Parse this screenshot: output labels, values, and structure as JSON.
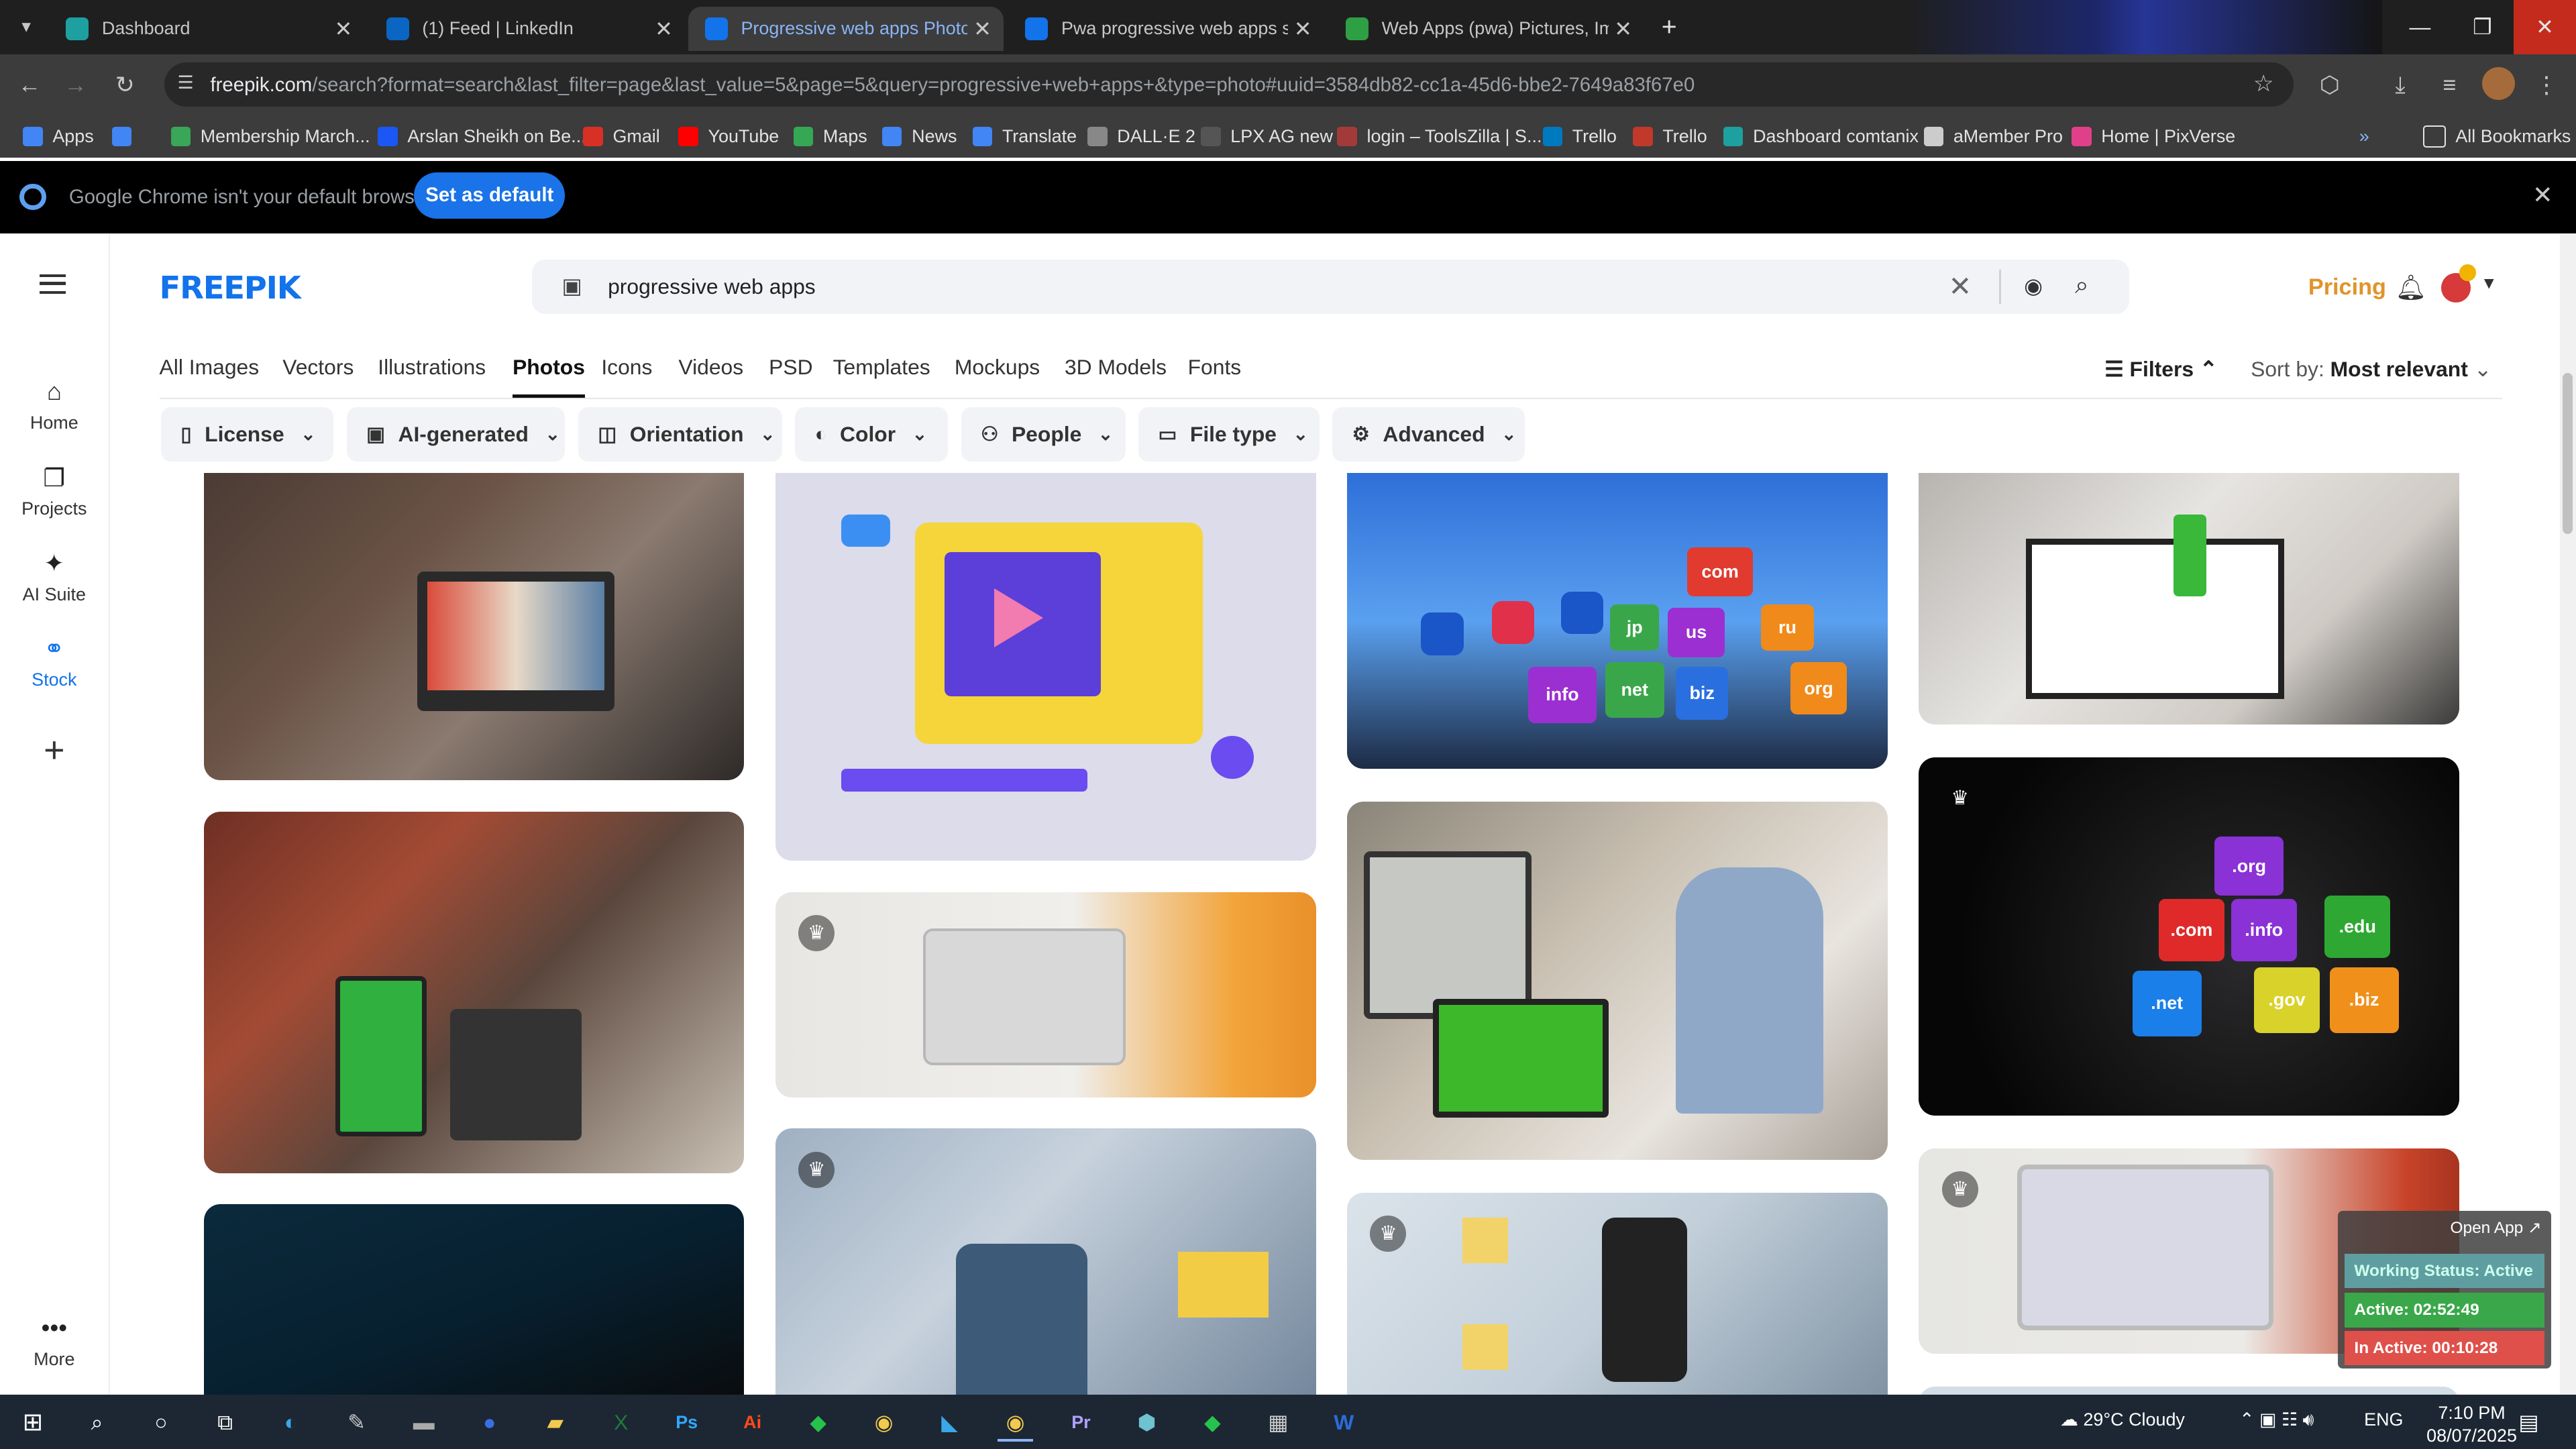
{
  "browser": {
    "tabs": [
      {
        "title": "Dashboard",
        "active": false,
        "favicon_color": "#1ea0a0"
      },
      {
        "title": "(1) Feed | LinkedIn",
        "active": false,
        "favicon_color": "#0a66c2"
      },
      {
        "title": "Progressive web apps Photos | Fr",
        "active": true,
        "favicon_color": "#1273eb"
      },
      {
        "title": "Pwa progressive web apps sma",
        "active": false,
        "favicon_color": "#1273eb"
      },
      {
        "title": "Web Apps (pwa) Pictures, Imag",
        "active": false,
        "favicon_color": "#2ea043"
      }
    ],
    "url_host": "freepik.com",
    "url_path": "/search?format=search&last_filter=page&last_value=5&page=5&query=progressive+web+apps+&type=photo#uuid=3584db82-cc1a-45d6-bbe2-7649a83f67e0",
    "bookmarks": [
      {
        "label": "Apps",
        "color": "#4285f4"
      },
      {
        "label": "",
        "color": "#4285f4"
      },
      {
        "label": "Membership March...",
        "color": "#3aa657"
      },
      {
        "label": "Arslan Sheikh on Be...",
        "color": "#1a57f5"
      },
      {
        "label": "Gmail",
        "color": "#d93025"
      },
      {
        "label": "YouTube",
        "color": "#ff0000"
      },
      {
        "label": "Maps",
        "color": "#34a853"
      },
      {
        "label": "News",
        "color": "#4285f4"
      },
      {
        "label": "Translate",
        "color": "#4285f4"
      },
      {
        "label": "DALL·E 2",
        "color": "#888888"
      },
      {
        "label": "LPX AG new",
        "color": "#555555"
      },
      {
        "label": "login – ToolsZilla | S...",
        "color": "#a33a3a"
      },
      {
        "label": "Trello",
        "color": "#0079bf"
      },
      {
        "label": "Trello",
        "color": "#c0392b"
      },
      {
        "label": "Dashboard comtanix",
        "color": "#1ea0a0"
      },
      {
        "label": "aMember Pro",
        "color": "#cccccc"
      },
      {
        "label": "Home | PixVerse",
        "color": "#e0408a"
      }
    ],
    "all_bookmarks": "All Bookmarks",
    "infobar_message": "Google Chrome isn't your default browser",
    "infobar_button": "Set as default"
  },
  "site": {
    "logo": "FREEPIK",
    "search_query": "progressive web apps",
    "pricing": "Pricing",
    "sidenav": [
      {
        "label": "Home",
        "icon": "home-icon",
        "glyph": "⌂"
      },
      {
        "label": "Projects",
        "icon": "projects-icon",
        "glyph": "❐"
      },
      {
        "label": "AI Suite",
        "icon": "ai-suite-icon",
        "glyph": "✦"
      },
      {
        "label": "Stock",
        "icon": "stock-icon",
        "glyph": "⚭"
      },
      {
        "label": "",
        "icon": "plus-icon",
        "glyph": "+"
      },
      {
        "label": "More",
        "icon": "more-icon",
        "glyph": "•••"
      }
    ],
    "type_tabs": [
      "All Images",
      "Vectors",
      "Illustrations",
      "Photos",
      "Icons",
      "Videos",
      "PSD",
      "Templates",
      "Mockups",
      "3D Models",
      "Fonts"
    ],
    "active_type_tab": "Photos",
    "filters_label": "Filters",
    "sort_label": "Sort by:",
    "sort_value": "Most relevant",
    "filter_chips": [
      {
        "label": "License",
        "icon": "license-icon"
      },
      {
        "label": "AI-generated",
        "icon": "ai-generated-icon"
      },
      {
        "label": "Orientation",
        "icon": "orientation-icon"
      },
      {
        "label": "Color",
        "icon": "color-icon"
      },
      {
        "label": "People",
        "icon": "people-icon"
      },
      {
        "label": "File type",
        "icon": "file-type-icon"
      },
      {
        "label": "Advanced",
        "icon": "advanced-icon"
      }
    ],
    "domain_cubes_1": [
      "com",
      "jp",
      "us",
      "ru",
      "info",
      "net",
      "biz",
      "org"
    ],
    "domain_cubes_2": [
      ".org",
      ".com",
      ".info",
      ".edu",
      ".net",
      ".gov",
      ".biz"
    ]
  },
  "status_widget": {
    "open_app": "Open App ↗",
    "working_status": "Working Status: Active",
    "active": "Active: 02:52:49",
    "inactive": "In Active: 00:10:28"
  },
  "taskbar": {
    "weather": "29°C  Cloudy",
    "lang": "ENG",
    "time": "7:10 PM",
    "date": "08/07/2025"
  }
}
